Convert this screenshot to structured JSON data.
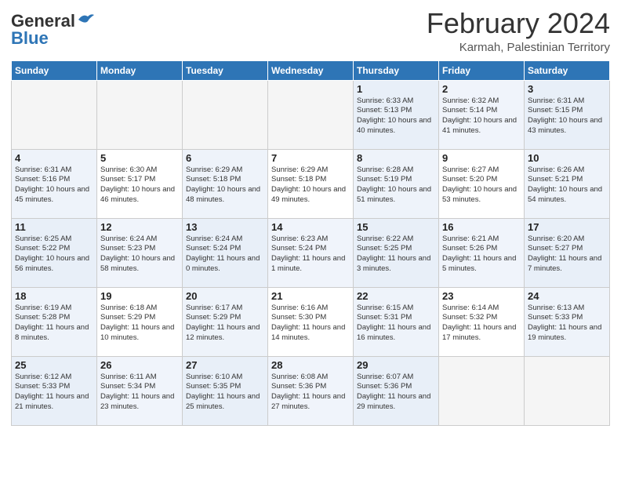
{
  "logo": {
    "line1": "General",
    "line2": "Blue"
  },
  "calendar": {
    "title": "February 2024",
    "subtitle": "Karmah, Palestinian Territory",
    "days_of_week": [
      "Sunday",
      "Monday",
      "Tuesday",
      "Wednesday",
      "Thursday",
      "Friday",
      "Saturday"
    ],
    "weeks": [
      [
        {
          "day": "",
          "info": ""
        },
        {
          "day": "",
          "info": ""
        },
        {
          "day": "",
          "info": ""
        },
        {
          "day": "",
          "info": ""
        },
        {
          "day": "1",
          "info": "Sunrise: 6:33 AM\nSunset: 5:13 PM\nDaylight: 10 hours and 40 minutes."
        },
        {
          "day": "2",
          "info": "Sunrise: 6:32 AM\nSunset: 5:14 PM\nDaylight: 10 hours and 41 minutes."
        },
        {
          "day": "3",
          "info": "Sunrise: 6:31 AM\nSunset: 5:15 PM\nDaylight: 10 hours and 43 minutes."
        }
      ],
      [
        {
          "day": "4",
          "info": "Sunrise: 6:31 AM\nSunset: 5:16 PM\nDaylight: 10 hours and 45 minutes."
        },
        {
          "day": "5",
          "info": "Sunrise: 6:30 AM\nSunset: 5:17 PM\nDaylight: 10 hours and 46 minutes."
        },
        {
          "day": "6",
          "info": "Sunrise: 6:29 AM\nSunset: 5:18 PM\nDaylight: 10 hours and 48 minutes."
        },
        {
          "day": "7",
          "info": "Sunrise: 6:29 AM\nSunset: 5:18 PM\nDaylight: 10 hours and 49 minutes."
        },
        {
          "day": "8",
          "info": "Sunrise: 6:28 AM\nSunset: 5:19 PM\nDaylight: 10 hours and 51 minutes."
        },
        {
          "day": "9",
          "info": "Sunrise: 6:27 AM\nSunset: 5:20 PM\nDaylight: 10 hours and 53 minutes."
        },
        {
          "day": "10",
          "info": "Sunrise: 6:26 AM\nSunset: 5:21 PM\nDaylight: 10 hours and 54 minutes."
        }
      ],
      [
        {
          "day": "11",
          "info": "Sunrise: 6:25 AM\nSunset: 5:22 PM\nDaylight: 10 hours and 56 minutes."
        },
        {
          "day": "12",
          "info": "Sunrise: 6:24 AM\nSunset: 5:23 PM\nDaylight: 10 hours and 58 minutes."
        },
        {
          "day": "13",
          "info": "Sunrise: 6:24 AM\nSunset: 5:24 PM\nDaylight: 11 hours and 0 minutes."
        },
        {
          "day": "14",
          "info": "Sunrise: 6:23 AM\nSunset: 5:24 PM\nDaylight: 11 hours and 1 minute."
        },
        {
          "day": "15",
          "info": "Sunrise: 6:22 AM\nSunset: 5:25 PM\nDaylight: 11 hours and 3 minutes."
        },
        {
          "day": "16",
          "info": "Sunrise: 6:21 AM\nSunset: 5:26 PM\nDaylight: 11 hours and 5 minutes."
        },
        {
          "day": "17",
          "info": "Sunrise: 6:20 AM\nSunset: 5:27 PM\nDaylight: 11 hours and 7 minutes."
        }
      ],
      [
        {
          "day": "18",
          "info": "Sunrise: 6:19 AM\nSunset: 5:28 PM\nDaylight: 11 hours and 8 minutes."
        },
        {
          "day": "19",
          "info": "Sunrise: 6:18 AM\nSunset: 5:29 PM\nDaylight: 11 hours and 10 minutes."
        },
        {
          "day": "20",
          "info": "Sunrise: 6:17 AM\nSunset: 5:29 PM\nDaylight: 11 hours and 12 minutes."
        },
        {
          "day": "21",
          "info": "Sunrise: 6:16 AM\nSunset: 5:30 PM\nDaylight: 11 hours and 14 minutes."
        },
        {
          "day": "22",
          "info": "Sunrise: 6:15 AM\nSunset: 5:31 PM\nDaylight: 11 hours and 16 minutes."
        },
        {
          "day": "23",
          "info": "Sunrise: 6:14 AM\nSunset: 5:32 PM\nDaylight: 11 hours and 17 minutes."
        },
        {
          "day": "24",
          "info": "Sunrise: 6:13 AM\nSunset: 5:33 PM\nDaylight: 11 hours and 19 minutes."
        }
      ],
      [
        {
          "day": "25",
          "info": "Sunrise: 6:12 AM\nSunset: 5:33 PM\nDaylight: 11 hours and 21 minutes."
        },
        {
          "day": "26",
          "info": "Sunrise: 6:11 AM\nSunset: 5:34 PM\nDaylight: 11 hours and 23 minutes."
        },
        {
          "day": "27",
          "info": "Sunrise: 6:10 AM\nSunset: 5:35 PM\nDaylight: 11 hours and 25 minutes."
        },
        {
          "day": "28",
          "info": "Sunrise: 6:08 AM\nSunset: 5:36 PM\nDaylight: 11 hours and 27 minutes."
        },
        {
          "day": "29",
          "info": "Sunrise: 6:07 AM\nSunset: 5:36 PM\nDaylight: 11 hours and 29 minutes."
        },
        {
          "day": "",
          "info": ""
        },
        {
          "day": "",
          "info": ""
        }
      ]
    ]
  }
}
